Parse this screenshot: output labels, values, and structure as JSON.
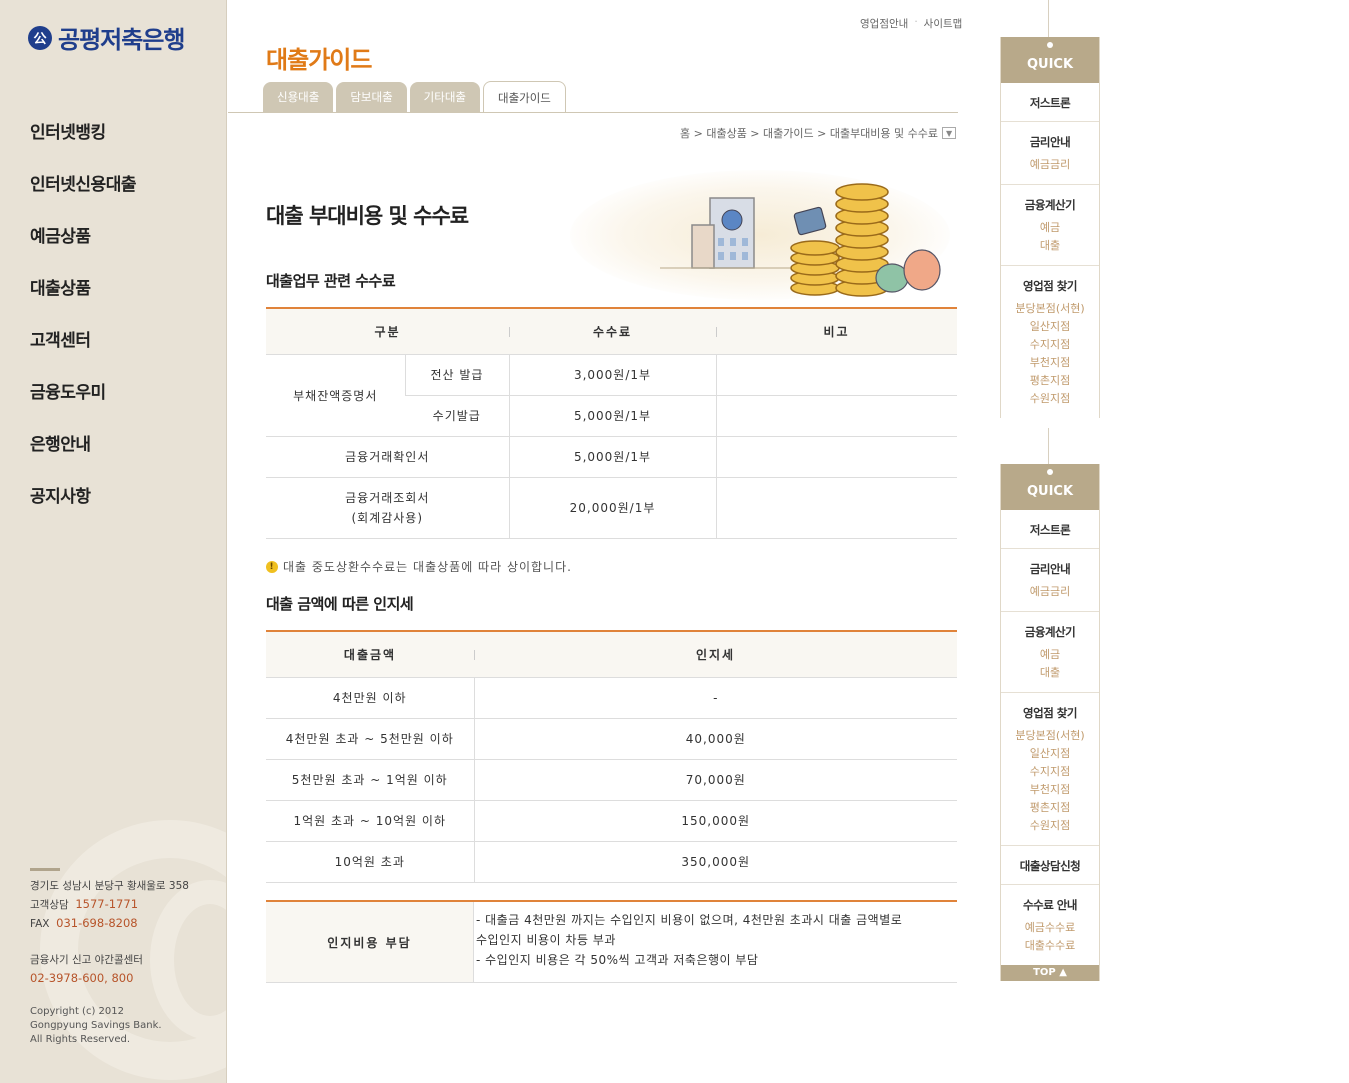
{
  "brand": {
    "name": "공평저축은행",
    "logo_mark": "公"
  },
  "gnb": [
    "인터넷뱅킹",
    "인터넷신용대출",
    "예금상품",
    "대출상품",
    "고객센터",
    "금융도우미",
    "은행안내",
    "공지사항"
  ],
  "footer": {
    "address": "경기도 성남시 분당구 황새울로 358",
    "phone_label": "고객상담",
    "phone": "1577-1771",
    "fax_label": "FAX",
    "fax": "031-698-8208",
    "fraud_label": "금융사기 신고 야간콜센터",
    "fraud_phone": "02-3978-600, 800",
    "copy1": "Copyright (c) 2012",
    "copy2": "Gongpyung Savings Bank.",
    "copy3": "All Rights Reserved."
  },
  "util": [
    "영업점안내",
    "사이트맵"
  ],
  "page_title": "대출가이드",
  "tabs": [
    "신용대출",
    "담보대출",
    "기타대출",
    "대출가이드"
  ],
  "breadcrumb": "홈 > 대출상품 > 대출가이드 > 대출부대비용 및 수수료",
  "section_title": "대출 부대비용 및 수수료",
  "fee_title": "대출업무 관련 수수료",
  "fee_table": {
    "headers": [
      "구분",
      "수수료",
      "비고"
    ],
    "group": "부채잔액증명서",
    "rows": [
      {
        "item": "전산 발급",
        "fee": "3,000원/1부",
        "note": ""
      },
      {
        "item": "수기발급",
        "fee": "5,000원/1부",
        "note": ""
      },
      {
        "item": "금융거래확인서",
        "fee": "5,000원/1부",
        "note": ""
      },
      {
        "item": "금융거래조회서",
        "item2": "(회계감사용)",
        "fee": "20,000원/1부",
        "note": ""
      }
    ]
  },
  "notice": "대출 중도상환수수료는 대출상품에 따라 상이합니다.",
  "stamp_title": "대출 금액에 따른 인지세",
  "stamp_table": {
    "headers": [
      "대출금액",
      "인지세"
    ],
    "rows": [
      [
        "4천만원 이하",
        "-"
      ],
      [
        "4천만원 초과 ~ 5천만원 이하",
        "40,000원"
      ],
      [
        "5천만원 초과 ~ 1억원 이하",
        "70,000원"
      ],
      [
        "1억원 초과 ~ 10억원 이하",
        "150,000원"
      ],
      [
        "10억원 초과",
        "350,000원"
      ]
    ]
  },
  "stamp_burden": {
    "label": "인지비용 부담",
    "lines": [
      "- 대출금 4천만원 까지는 수입인지 비용이 없으며, 4천만원 초과시 대출 금액별로",
      "수입인지 비용이 차등 부과",
      "- 수입인지 비용은 각 50%씩 고객과 저축은행이 부담"
    ]
  },
  "quick": {
    "head": "QUICK",
    "items": [
      {
        "title": "저스트론",
        "subs": []
      },
      {
        "title": "금리안내",
        "subs": [
          "예금금리"
        ]
      },
      {
        "title": "금융계산기",
        "subs": [
          "예금",
          "대출"
        ]
      },
      {
        "title": "영업점 찾기",
        "subs": [
          "분당본점(서현)",
          "일산지점",
          "수지지점",
          "부천지점",
          "평촌지점",
          "수원지점"
        ]
      }
    ],
    "extra": [
      {
        "title": "대출상담신청",
        "subs": []
      },
      {
        "title": "수수료 안내",
        "subs": [
          "예금수수료",
          "대출수수료"
        ]
      }
    ],
    "top": "TOP ▲"
  }
}
